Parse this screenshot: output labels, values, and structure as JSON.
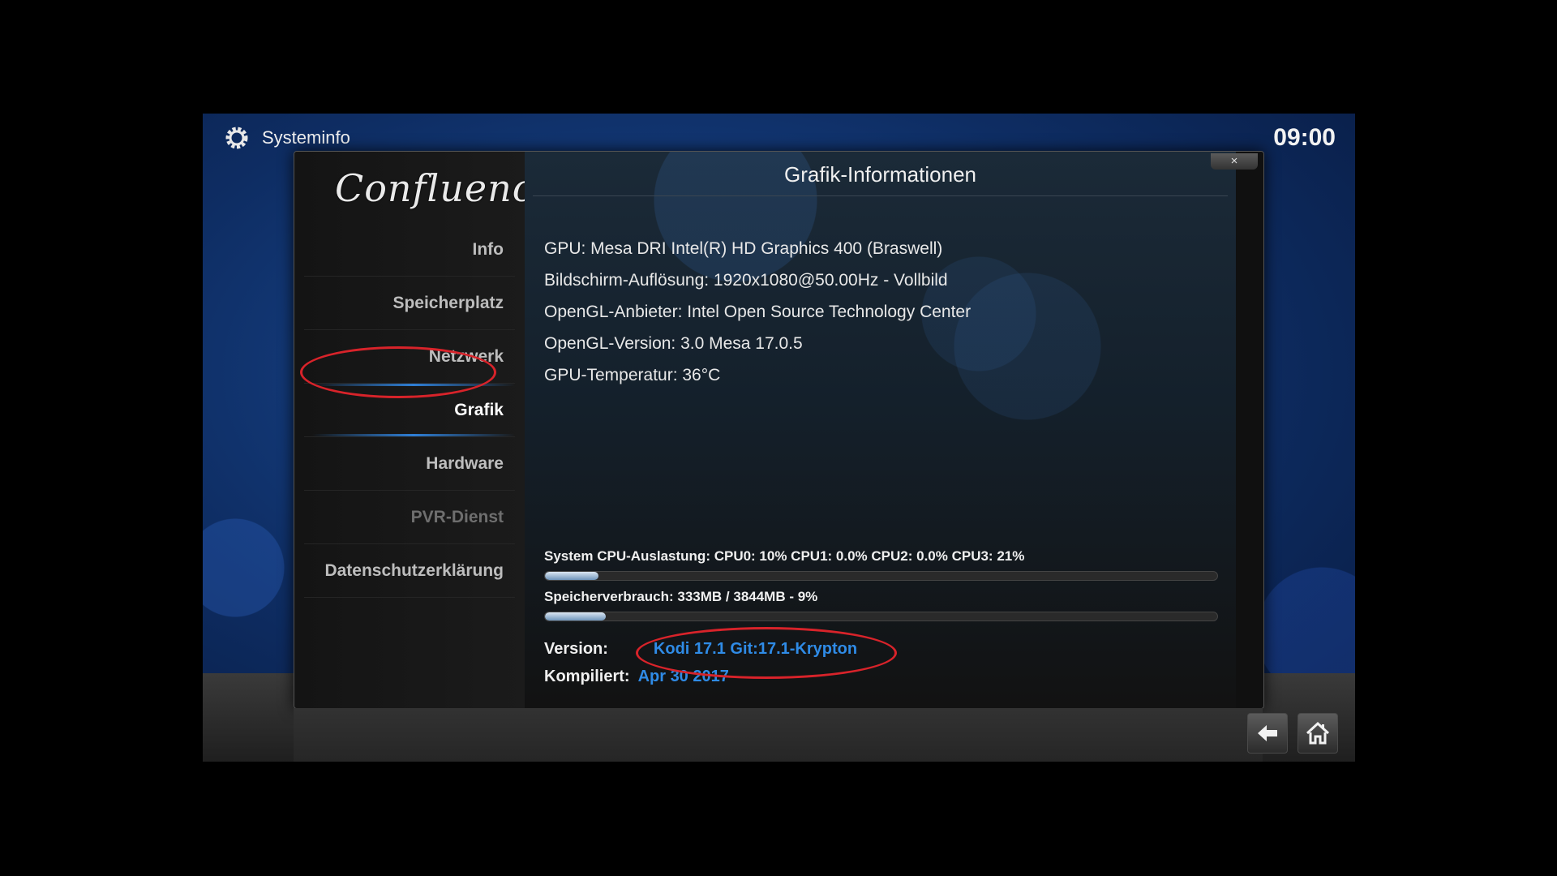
{
  "window": {
    "title": "Systeminfo",
    "clock": "09:00"
  },
  "dialog": {
    "title": "Grafik-Informationen",
    "close_label": "×",
    "logo_text": "Confluence"
  },
  "sidebar": {
    "items": [
      {
        "label": "Info",
        "state": "normal"
      },
      {
        "label": "Speicherplatz",
        "state": "normal"
      },
      {
        "label": "Netzwerk",
        "state": "normal"
      },
      {
        "label": "Grafik",
        "state": "active"
      },
      {
        "label": "Hardware",
        "state": "normal"
      },
      {
        "label": "PVR-Dienst",
        "state": "disabled"
      },
      {
        "label": "Datenschutzerklärung",
        "state": "normal"
      }
    ]
  },
  "info": {
    "lines": [
      "GPU: Mesa DRI Intel(R) HD Graphics 400 (Braswell)",
      "Bildschirm-Auflösung: 1920x1080@50.00Hz - Vollbild",
      "OpenGL-Anbieter: Intel Open Source Technology Center",
      "OpenGL-Version:  3.0 Mesa 17.0.5",
      "GPU-Temperatur: 36°C"
    ]
  },
  "stats": {
    "cpu_label": "System CPU-Auslastung: CPU0:  10% CPU1: 0.0% CPU2: 0.0% CPU3:  21%",
    "cpu_fraction": 0.08,
    "mem_label": "Speicherverbrauch: 333MB / 3844MB - 9%",
    "mem_fraction": 0.09
  },
  "version": {
    "version_label": "Version:",
    "version_value": "Kodi 17.1 Git:17.1-Krypton",
    "compiled_label": "Kompiliert:",
    "compiled_value": "Apr 30 2017"
  },
  "colors": {
    "accent": "#2f8be6",
    "highlight": "#d8232a"
  },
  "icons": [
    "gear-icon",
    "close-icon",
    "back-arrow-icon",
    "home-icon"
  ]
}
